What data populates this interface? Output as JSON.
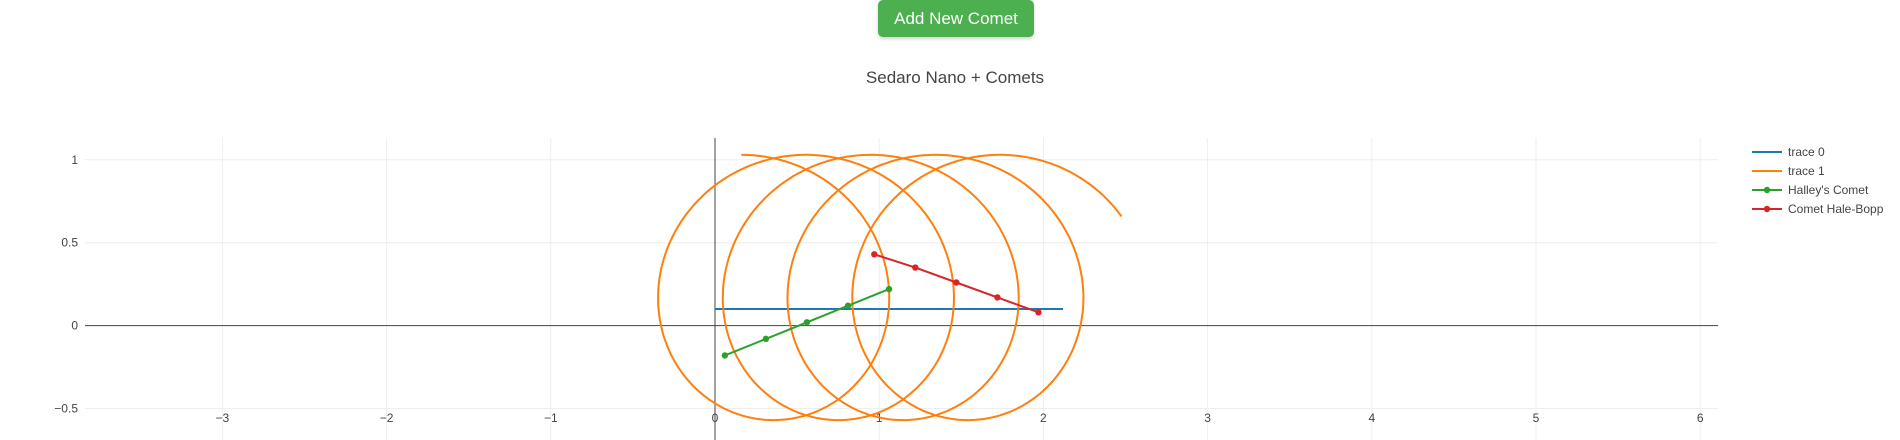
{
  "toolbar": {
    "add_comet_label": "Add New Comet"
  },
  "chart_data": {
    "type": "line",
    "title": "Sedaro Nano + Comets",
    "xlim": [
      -3.5,
      6.1
    ],
    "ylim": [
      -0.5,
      1.1
    ],
    "xticks": [
      -3,
      -2,
      -1,
      0,
      1,
      2,
      3,
      4,
      5,
      6
    ],
    "yticks": [
      -0.5,
      0,
      0.5,
      1
    ],
    "xtick_labels": [
      "−3",
      "−2",
      "−1",
      "0",
      "1",
      "2",
      "3",
      "4",
      "5",
      "6"
    ],
    "ytick_labels": [
      "−0.5",
      "0",
      "0.5",
      "1"
    ],
    "grid": true,
    "legend_position": "top-right",
    "series": [
      {
        "name": "trace 0",
        "color": "#1f77b4",
        "mode": "lines",
        "x": [
          0,
          2.12
        ],
        "y": [
          0.1,
          0.1
        ]
      },
      {
        "name": "trace 1",
        "color": "#ff7f0e",
        "mode": "lines",
        "orbit": {
          "radius": 0.8,
          "center_start": [
            0.16,
            0.23
          ],
          "center_end": [
            1.8,
            0.23
          ],
          "start_angle_deg": 0,
          "turns": 4.16
        }
      },
      {
        "name": "Halley's Comet",
        "color": "#2ca02c",
        "mode": "lines+markers",
        "x": [
          0.06,
          0.31,
          0.56,
          0.81,
          1.06
        ],
        "y": [
          -0.18,
          -0.08,
          0.02,
          0.12,
          0.22
        ]
      },
      {
        "name": "Comet Hale-Bopp",
        "color": "#d62728",
        "mode": "lines+markers",
        "x": [
          0.97,
          1.22,
          1.47,
          1.72,
          1.97
        ],
        "y": [
          0.43,
          0.35,
          0.26,
          0.17,
          0.08
        ]
      }
    ]
  }
}
